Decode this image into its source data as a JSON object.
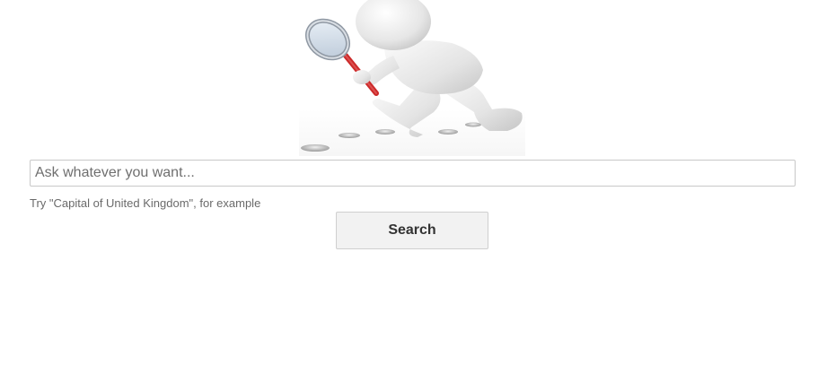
{
  "hero": {
    "illustration": "magnifying-glass-figure"
  },
  "search": {
    "placeholder": "Ask whatever you want...",
    "value": "",
    "hint": "Try \"Capital of United Kingdom\", for example",
    "button_label": "Search"
  },
  "colors": {
    "magnifier_handle": "#cc2a2a",
    "button_background": "#f2f2f2",
    "input_border": "#c8c8c8"
  }
}
